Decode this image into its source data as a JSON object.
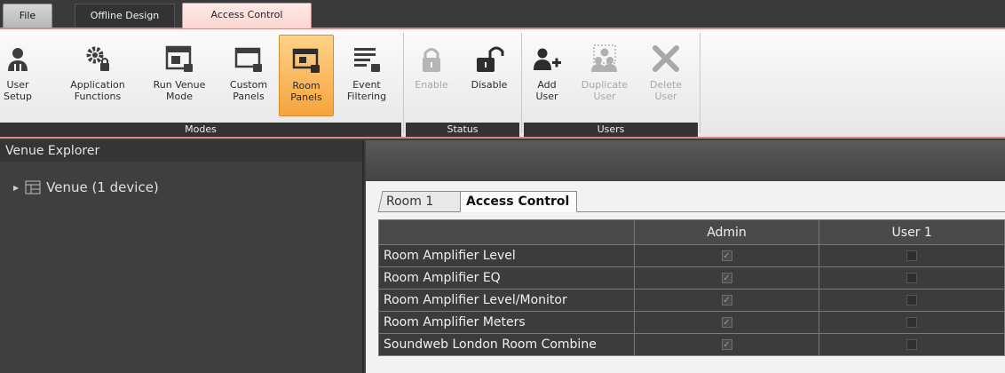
{
  "menu": {
    "file": "File",
    "offline_design": "Offline Design",
    "access_control": "Access Control"
  },
  "ribbon": {
    "modes": {
      "caption": "Modes",
      "buttons": [
        {
          "label": "User\nSetup",
          "icon": "user-setup-icon"
        },
        {
          "label": "Application\nFunctions",
          "icon": "application-functions-icon"
        },
        {
          "label": "Run Venue\nMode",
          "icon": "run-venue-mode-icon"
        },
        {
          "label": "Custom\nPanels",
          "icon": "custom-panels-icon"
        },
        {
          "label": "Room\nPanels",
          "icon": "room-panels-icon",
          "active": true
        },
        {
          "label": "Event\nFiltering",
          "icon": "event-filtering-icon"
        }
      ]
    },
    "status": {
      "caption": "Status",
      "buttons": [
        {
          "label": "Enable",
          "icon": "lock-icon",
          "disabled": true
        },
        {
          "label": "Disable",
          "icon": "unlock-icon"
        }
      ]
    },
    "users": {
      "caption": "Users",
      "buttons": [
        {
          "label": "Add\nUser",
          "icon": "add-user-icon"
        },
        {
          "label": "Duplicate\nUser",
          "icon": "duplicate-user-icon",
          "disabled": true
        },
        {
          "label": "Delete\nUser",
          "icon": "delete-user-icon",
          "disabled": true
        }
      ]
    },
    "accent_color": "#f7a43c"
  },
  "explorer": {
    "title": "Venue Explorer",
    "tree_item": "Venue (1 device)"
  },
  "main": {
    "tabs": [
      "Room 1",
      "Access Control"
    ],
    "active_tab": "Access Control",
    "columns": [
      "",
      "Admin",
      "User 1"
    ],
    "rows": [
      {
        "name": "Room Amplifier Level",
        "admin": true,
        "user1": false
      },
      {
        "name": "Room Amplifier EQ",
        "admin": true,
        "user1": false
      },
      {
        "name": "Room Amplifier Level/Monitor",
        "admin": true,
        "user1": false
      },
      {
        "name": "Room Amplifier Meters",
        "admin": true,
        "user1": false
      },
      {
        "name": "Soundweb London Room Combine",
        "admin": true,
        "user1": false
      }
    ]
  }
}
